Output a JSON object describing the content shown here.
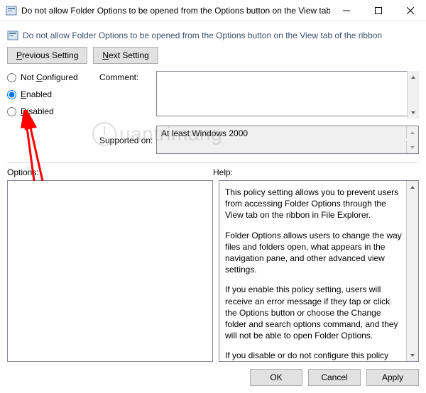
{
  "window": {
    "title": "Do not allow Folder Options to be opened from the Options button on the View tab of the ribbon"
  },
  "header": {
    "text": "Do not allow Folder Options to be opened from the Options button on the View tab of the ribbon"
  },
  "nav": {
    "previous": "Previous Setting",
    "next": "Next Setting"
  },
  "state": {
    "not_configured": "Not Configured",
    "enabled": "Enabled",
    "disabled": "Disabled",
    "selected": "enabled"
  },
  "labels": {
    "comment": "Comment:",
    "supported": "Supported on:",
    "options": "Options:",
    "help": "Help:"
  },
  "fields": {
    "comment": "",
    "supported": "At least Windows 2000"
  },
  "help": {
    "p1": "This policy setting allows you to prevent users from accessing Folder Options through the View tab on the ribbon in File Explorer.",
    "p2": "Folder Options allows users to change the way files and folders open, what appears in the navigation pane, and other advanced view settings.",
    "p3": "If you enable this policy setting, users will receive an error message if they tap or click the Options button or choose the Change folder and search options command, and they will not be able to open Folder Options.",
    "p4": "If you disable or do not configure this policy setting, users can open Folder Options from the View tab on the ribbon."
  },
  "buttons": {
    "ok": "OK",
    "cancel": "Cancel",
    "apply": "Apply"
  },
  "watermark": "uantrimang"
}
